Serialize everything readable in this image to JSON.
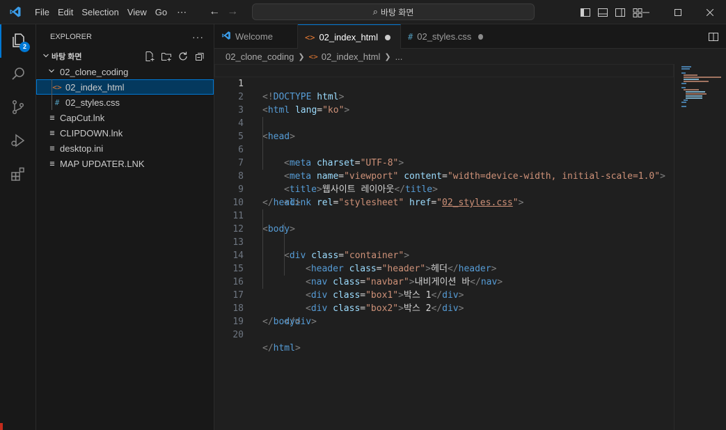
{
  "titlebar": {
    "logo_icon": "vscode-logo-icon",
    "menus": [
      "File",
      "Edit",
      "Selection",
      "View",
      "Go"
    ],
    "more_menu": "⋯",
    "search_text": "바탕 화면"
  },
  "activitybar": {
    "items": [
      "explorer-icon",
      "search-icon",
      "source-control-icon",
      "run-debug-icon",
      "extensions-icon"
    ],
    "explorer_badge": "2"
  },
  "sidebar": {
    "title": "EXPLORER",
    "more": "···",
    "root_folder": "바탕 화면",
    "folder": "02_clone_coding",
    "folder_files": [
      {
        "name": "02_index_html",
        "icon": "<>"
      },
      {
        "name": "02_styles.css",
        "icon": "#"
      }
    ],
    "root_files": [
      "CapCut.lnk",
      "CLIPDOWN.lnk",
      "desktop.ini",
      "MAP UPDATER.LNK"
    ]
  },
  "tabs": [
    {
      "label": "Welcome",
      "icon": "◆"
    },
    {
      "label": "02_index_html",
      "icon": "<>"
    },
    {
      "label": "02_styles.css",
      "icon": "#"
    }
  ],
  "breadcrumb": {
    "folder": "02_clone_coding",
    "file": "02_index_html",
    "rest": "..."
  },
  "editor": {
    "line_numbers": [
      "1",
      "2",
      "3",
      "4",
      "5",
      "6",
      "7",
      "8",
      "9",
      "10",
      "11",
      "12",
      "13",
      "14",
      "15",
      "16",
      "17",
      "18",
      "19",
      "20"
    ],
    "colors": {
      "tag": "#569cd6",
      "attr": "#9cdcfe",
      "string": "#ce9178",
      "text": "#d4d4d4",
      "bracket": "#808080"
    },
    "code": {
      "l1_open": "<!",
      "l1_doctype": "DOCTYPE",
      "l1_html": "html",
      "l1_close": ">",
      "lang_attr": "lang",
      "lang_val": "\"ko\"",
      "t_html": "html",
      "t_head": "head",
      "t_meta": "meta",
      "t_title": "title",
      "t_link": "link",
      "t_body": "body",
      "t_div": "div",
      "t_header": "header",
      "t_nav": "nav",
      "a_charset": "charset",
      "v_charset": "\"UTF-8\"",
      "a_name": "name",
      "v_name": "\"viewport\"",
      "a_content": "content",
      "v_content": "\"width=device-width, initial-scale=1.0\"",
      "title_text": "웹사이트 레이아웃",
      "a_rel": "rel",
      "v_rel": "\"stylesheet\"",
      "a_href": "href",
      "v_href_q": "\"",
      "v_href": "02_styles.css",
      "a_class": "class",
      "v_container": "\"container\"",
      "v_header": "\"header\"",
      "txt_header": "헤더",
      "v_navbar": "\"navbar\"",
      "txt_nav": "내비게이션 바",
      "v_box1": "\"box1\"",
      "txt_box1": "박스 1",
      "v_box2": "\"box2\"",
      "txt_box2": "박스 2",
      "lt": "<",
      "lts": "</",
      "gt": ">",
      "eq": "="
    }
  }
}
